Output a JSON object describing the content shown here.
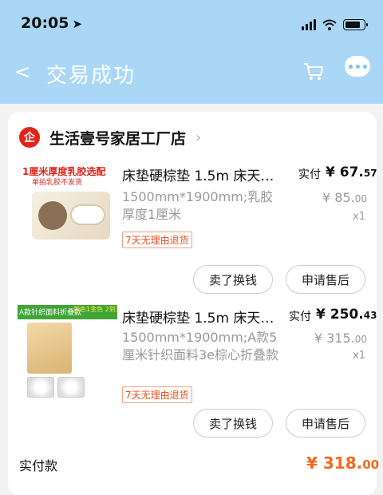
{
  "status_bar": {
    "time": "20:05"
  },
  "nav": {
    "title": "交易成功"
  },
  "shop": {
    "logo": "企",
    "name": "生活壹号家居工厂店"
  },
  "items": [
    {
      "thumb_title": "1厘米厚度乳胶选配",
      "thumb_subtitle": "单拍乳胶不发货",
      "name": "床垫硬棕垫 1.5m 床天…",
      "spec": "1500mm*1900mm;乳胶厚度1厘米",
      "tag": "7天无理由退货",
      "paid_label": "实付",
      "paid_currency": "¥",
      "paid_int": "67.",
      "paid_dec": "57",
      "orig_currency": "¥",
      "orig_int": "85.",
      "orig_dec": "00",
      "qty": "x1",
      "btn_sell": "卖了换钱",
      "btn_after_sale": "申请售后"
    },
    {
      "thumb_band": "A款针织面料折叠款",
      "thumb_tag": "颜色1金色  2到3件",
      "name": "床垫硬棕垫 1.5m 床天…",
      "spec": "1500mm*1900mm;A款5厘米针织面料3e棕心折叠款",
      "tag": "7天无理由退货",
      "paid_label": "实付",
      "paid_currency": "¥",
      "paid_int": "250.",
      "paid_dec": "43",
      "orig_currency": "¥",
      "orig_int": "315.",
      "orig_dec": "00",
      "qty": "x1",
      "btn_sell": "卖了换钱",
      "btn_after_sale": "申请售后"
    }
  ],
  "total": {
    "label": "实付款",
    "currency": "¥",
    "int": "318.",
    "dec": "00"
  },
  "icons": [
    "location-arrow-icon",
    "signal-icon",
    "wifi-icon",
    "battery-icon",
    "back-icon",
    "cart-icon",
    "more-icon",
    "chevron-right-icon"
  ],
  "colors": {
    "header": "#a9d7f5",
    "price_accent": "#f06a1f",
    "shop_logo": "#e2231a"
  }
}
